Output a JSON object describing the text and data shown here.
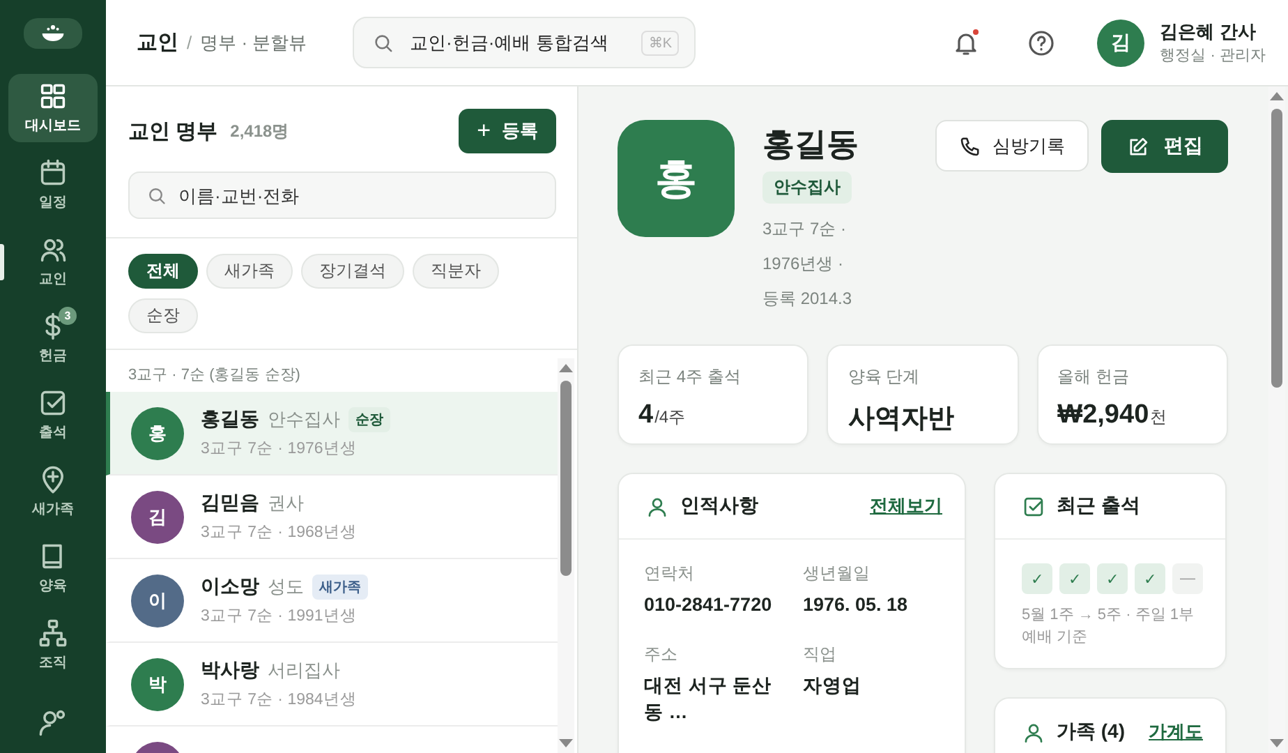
{
  "sidebar": {
    "items": [
      {
        "label": "대시보드",
        "selected": true,
        "indicator": false
      },
      {
        "label": "일정",
        "selected": false,
        "indicator": false
      },
      {
        "label": "교인",
        "selected": false,
        "indicator": true
      },
      {
        "label": "헌금",
        "selected": false,
        "indicator": false,
        "badge": "3"
      },
      {
        "label": "출석",
        "selected": false,
        "indicator": false
      },
      {
        "label": "새가족",
        "selected": false,
        "indicator": false
      },
      {
        "label": "양육",
        "selected": false,
        "indicator": false
      },
      {
        "label": "조직",
        "selected": false,
        "indicator": false
      },
      {
        "selected": false,
        "indicator": false
      }
    ]
  },
  "topbar": {
    "breadcrumb": {
      "current": "교인",
      "separator": "/",
      "sub": "명부 · 분할뷰"
    },
    "search": {
      "placeholder": "교인·헌금·예배 통합검색",
      "shortcut": "⌘K"
    },
    "notifications": {
      "unread": true
    },
    "user": {
      "initial": "김",
      "name": "김은혜 간사",
      "role": "행정실 · 관리자"
    }
  },
  "member_list": {
    "title": "교인 명부",
    "count": "2,418명",
    "add_button": {
      "icon": "+",
      "label": "등록"
    },
    "search": {
      "placeholder": "이름·교번·전화"
    },
    "filters": [
      {
        "label": "전체",
        "selected": true
      },
      {
        "label": "새가족",
        "selected": false
      },
      {
        "label": "장기결석",
        "selected": false
      },
      {
        "label": "직분자",
        "selected": false
      },
      {
        "label": "순장",
        "selected": false
      }
    ],
    "group_header": "3교구 · 7순 (홍길동 순장)",
    "rows": [
      {
        "initial": "홍",
        "color": "#2e7d4f",
        "name": "홍길동",
        "role": "안수집사",
        "tag": {
          "kind": "leader",
          "label": "순장"
        },
        "detail": "3교구 7순 · 1976년생",
        "selected": true
      },
      {
        "initial": "김",
        "color": "#7a4a82",
        "name": "김믿음",
        "role": "권사",
        "detail": "3교구 7순 · 1968년생",
        "selected": false
      },
      {
        "initial": "이",
        "color": "#536b88",
        "name": "이소망",
        "role": "성도",
        "tag": {
          "kind": "new",
          "label": "새가족"
        },
        "detail": "3교구 7순 · 1991년생",
        "selected": false
      },
      {
        "initial": "박",
        "color": "#2e7d4f",
        "name": "박사랑",
        "role": "서리집사",
        "detail": "3교구 7순 · 1984년생",
        "selected": false
      },
      {
        "color": "#7a4a82",
        "selected": false
      }
    ]
  },
  "profile": {
    "initial": "홍",
    "name": "홍길동",
    "title": "안수집사",
    "meta": [
      "3교구 7순 ·",
      "1976년생 ·",
      "등록 2014.3"
    ],
    "visit_button": "심방기록",
    "edit_button": "편집"
  },
  "stats": [
    {
      "label": "최근 4주 출석",
      "value": "4",
      "unit": "/4주"
    },
    {
      "label": "양육 단계",
      "value": "사역자반"
    },
    {
      "label": "올해 헌금",
      "value": "₩2,940",
      "unit": "천"
    }
  ],
  "personal_info": {
    "title": "인적사항",
    "link": "전체보기",
    "fields": [
      {
        "label": "연락처",
        "value": "010-2841-7720"
      },
      {
        "label": "생년월일",
        "value": "1976. 05. 18"
      },
      {
        "label": "주소",
        "value": "대전 서구 둔산동 …"
      },
      {
        "label": "직업",
        "value": "자영업"
      }
    ]
  },
  "attendance": {
    "title": "최근 출석",
    "weeks": [
      {
        "mark": "✓",
        "attended": true
      },
      {
        "mark": "✓",
        "attended": true
      },
      {
        "mark": "✓",
        "attended": true
      },
      {
        "mark": "✓",
        "attended": true
      },
      {
        "mark": "—",
        "attended": false
      }
    ],
    "note": "5월 1주 → 5주 · 주일 1부 예배 기준"
  },
  "family": {
    "title": "가족 (4)",
    "link": "가계도"
  }
}
